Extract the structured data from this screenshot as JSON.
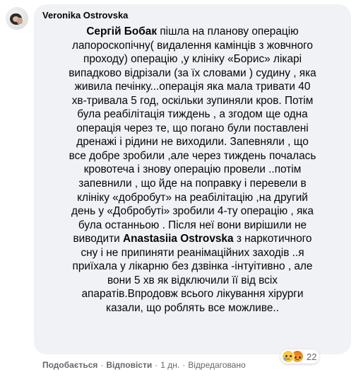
{
  "comment": {
    "author": "Veronika Ostrovska",
    "body_lines": [
      [
        {
          "t": "Сергій Бобак",
          "m": true
        },
        {
          "t": " пішла на планову операцію"
        }
      ],
      [
        {
          "t": "лапороскопічну( видалення камінців з жовчного"
        }
      ],
      [
        {
          "t": "проходу) операцію ,у клініку «Борис» лікарі"
        }
      ],
      [
        {
          "t": "випадково відрізали (за їх словами ) судину , яка"
        }
      ],
      [
        {
          "t": "живила печінку...операція яка мала тривати 40"
        }
      ],
      [
        {
          "t": "хв-тривала 5 год, оскільки зупиняли кров. Потім"
        }
      ],
      [
        {
          "t": "була реабілітація тиждень , а згодом ще одна"
        }
      ],
      [
        {
          "t": "операція через те, що погано були поставлені"
        }
      ],
      [
        {
          "t": "дренажі і рідини не виходили. Запевняли , що"
        }
      ],
      [
        {
          "t": "все добре зробили ,але через тиждень почалась"
        }
      ],
      [
        {
          "t": "кровотеча і знову операцію провели ..потім"
        }
      ],
      [
        {
          "t": "запевнили , що йде на поправку і перевели в"
        }
      ],
      [
        {
          "t": "клініку «добробут» на реабілітацію ,на другий"
        }
      ],
      [
        {
          "t": "день у «Добробуті» зробили 4-ту операцію , яка"
        }
      ],
      [
        {
          "t": "була останньою . Після неї вони вирішили не"
        }
      ],
      [
        {
          "t": "виводити "
        },
        {
          "t": "Anastasiia Ostrovska",
          "m": true
        },
        {
          "t": " з наркотичного"
        }
      ],
      [
        {
          "t": "сну і не припиняти реанімаційних заходів ..я"
        }
      ],
      [
        {
          "t": "приїхала у лікарню без дзвінка -інтуітивно , але"
        }
      ],
      [
        {
          "t": "вони 5 хв як відключили її від всіх"
        }
      ],
      [
        {
          "t": "апаратів.Впродовж всього лікування хірурги"
        }
      ],
      [
        {
          "t": "казали, що роблять все можливе.."
        }
      ]
    ]
  },
  "reactions": {
    "icons": [
      "sad-reaction",
      "angry-reaction"
    ],
    "count": "22"
  },
  "actions": {
    "like": "Подобається",
    "separator": "·",
    "reply": "Відповісти",
    "time": "1 дн.",
    "edited": "Відредаговано"
  }
}
